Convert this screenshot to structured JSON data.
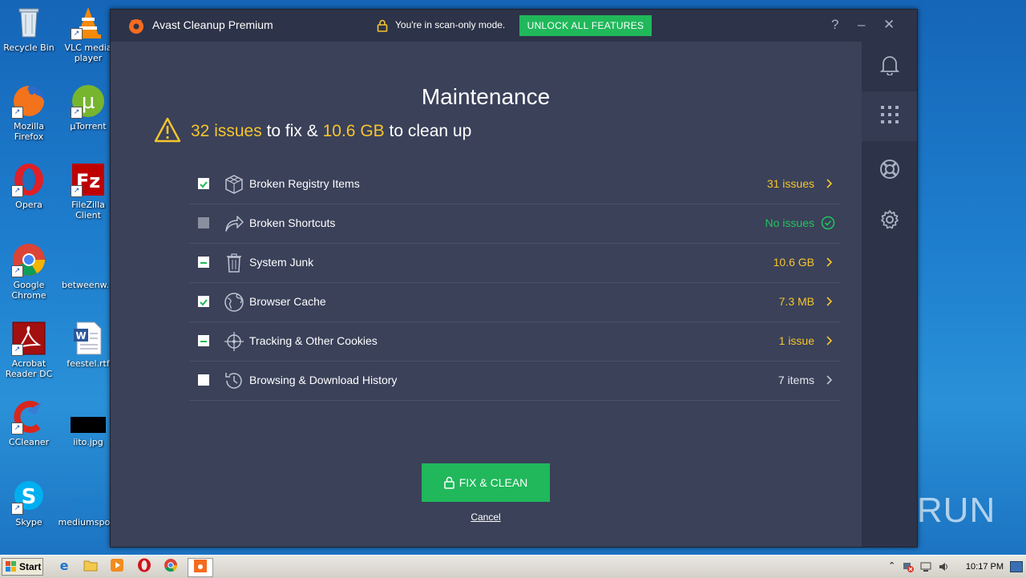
{
  "desktop": {
    "icons": [
      {
        "label": "Recycle Bin"
      },
      {
        "label": "VLC media player"
      },
      {
        "label": "Mozilla Firefox"
      },
      {
        "label": "µTorrent"
      },
      {
        "label": "Opera"
      },
      {
        "label": "FileZilla Client"
      },
      {
        "label": "Google Chrome"
      },
      {
        "label": "betweenw..."
      },
      {
        "label": "Acrobat Reader DC"
      },
      {
        "label": "feestel.rtf"
      },
      {
        "label": "CCleaner"
      },
      {
        "label": "iito.jpg"
      },
      {
        "label": "Skype"
      },
      {
        "label": "mediumspo..."
      }
    ]
  },
  "window": {
    "app_title": "Avast Cleanup Premium",
    "scan_mode_text": "You're in scan-only mode.",
    "unlock_label": "UNLOCK ALL FEATURES",
    "help_label": "?",
    "minimize_label": "–",
    "close_label": "✕"
  },
  "main": {
    "heading": "Maintenance",
    "summary": {
      "issues_count": "32 issues",
      "text_1": "to fix &",
      "size": "10.6 GB",
      "text_2": "to clean up"
    },
    "items": [
      {
        "label": "Broken Registry Items",
        "value": "31 issues",
        "state": "checked",
        "value_color": "yellow"
      },
      {
        "label": "Broken Shortcuts",
        "value": "No issues",
        "state": "disabled",
        "value_color": "green"
      },
      {
        "label": "System Junk",
        "value": "10.6 GB",
        "state": "partial",
        "value_color": "yellow"
      },
      {
        "label": "Browser Cache",
        "value": "7.3 MB",
        "state": "checked",
        "value_color": "yellow"
      },
      {
        "label": "Tracking & Other Cookies",
        "value": "1 issue",
        "state": "partial",
        "value_color": "yellow"
      },
      {
        "label": "Browsing & Download History",
        "value": "7 items",
        "state": "empty",
        "value_color": "white"
      }
    ],
    "fix_button_label": "FIX & CLEAN",
    "cancel_label": "Cancel"
  },
  "sidebar": {
    "icons": [
      "bell-icon",
      "grid-icon",
      "lifebuoy-icon",
      "gear-icon"
    ]
  },
  "watermark": "ANY RUN",
  "taskbar": {
    "start_label": "Start",
    "clock": "10:17 PM"
  },
  "colors": {
    "accent_green": "#20b85b",
    "highlight_yellow": "#f7c52d",
    "window_bg": "#3a4159",
    "titlebar_bg": "#2d3348"
  }
}
